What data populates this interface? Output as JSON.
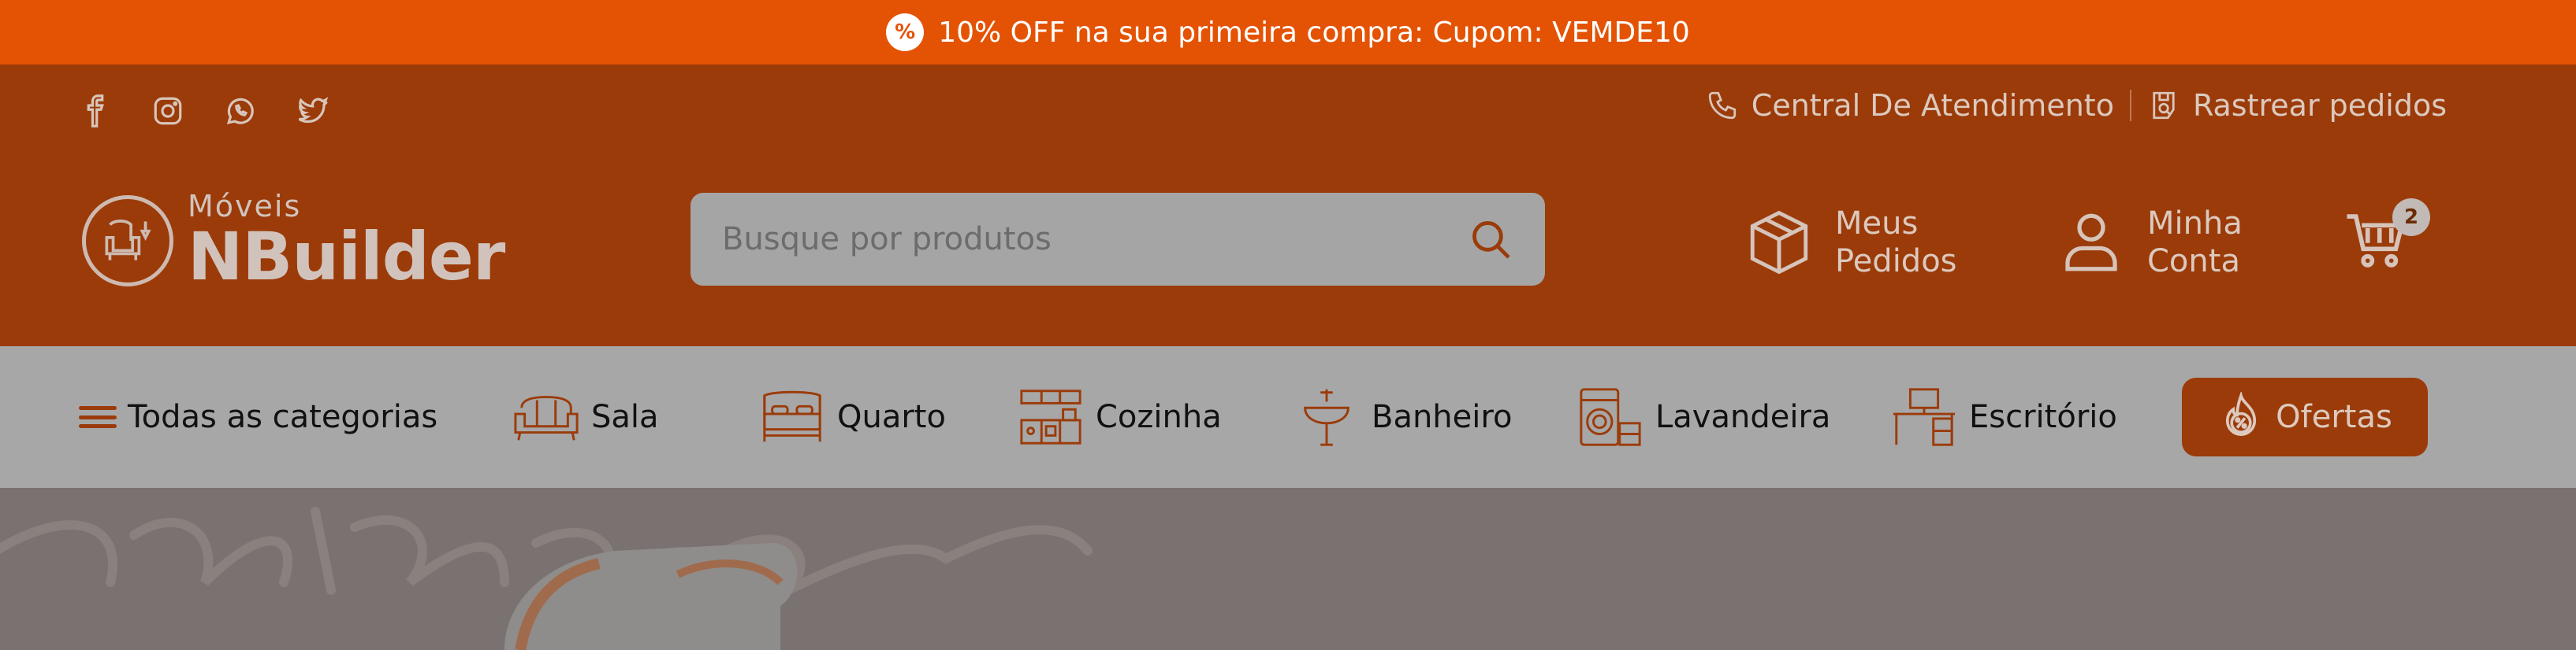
{
  "promo": {
    "badge_symbol": "%",
    "text": "10% OFF na sua primeira compra: Cupom: VEMDE10"
  },
  "social": [
    "facebook-icon",
    "instagram-icon",
    "whatsapp-icon",
    "twitter-icon"
  ],
  "utility": {
    "support_label": "Central De Atendimento",
    "track_label": "Rastrear pedidos"
  },
  "logo": {
    "small": "Móveis",
    "big": "NBuilder"
  },
  "search": {
    "placeholder": "Busque por produtos"
  },
  "header": {
    "orders_line1": "Meus",
    "orders_line2": "Pedidos",
    "account_line1": "Minha",
    "account_line2": "Conta",
    "cart_count": "2"
  },
  "nav": {
    "all_categories": "Todas as categorias",
    "items": [
      {
        "label": "Sala",
        "icon": "sofa-icon"
      },
      {
        "label": "Quarto",
        "icon": "bed-icon"
      },
      {
        "label": "Cozinha",
        "icon": "kitchen-icon"
      },
      {
        "label": "Banheiro",
        "icon": "sink-icon"
      },
      {
        "label": "Lavandeira",
        "icon": "washing-machine-icon"
      },
      {
        "label": "Escritório",
        "icon": "desk-icon"
      }
    ],
    "offers": "Ofertas"
  },
  "colors": {
    "promo_bg": "#e45303",
    "header_bg": "#9b3b0a",
    "nav_bg": "#a7a7a7",
    "accent": "#9b3b0a"
  }
}
